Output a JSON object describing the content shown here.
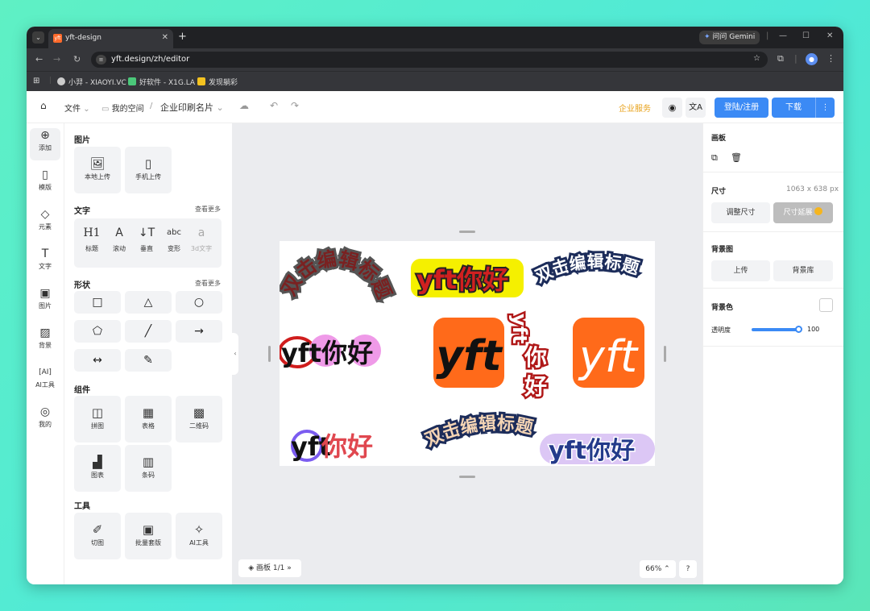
{
  "browser": {
    "tab_title": "yft-design",
    "gemini_label": "问问 Gemini",
    "url": "yft.design/zh/editor",
    "bookmarks": [
      "小羿 - XIAOYI.VC",
      "好软件 - X1G.LA",
      "发现躺彩"
    ]
  },
  "topbar": {
    "file_label": "文件",
    "space_label": "我的空间",
    "separator": "/",
    "doc_title": "企业印刷名片",
    "enterprise_label": "企业服务",
    "login_label": "登陆/注册",
    "download_label": "下载"
  },
  "rail": [
    {
      "icon": "plus-circle-icon",
      "label": "添加"
    },
    {
      "icon": "template-icon",
      "label": "模版"
    },
    {
      "icon": "shapes-icon",
      "label": "元素"
    },
    {
      "icon": "text-icon",
      "label": "文字"
    },
    {
      "icon": "image-icon",
      "label": "图片"
    },
    {
      "icon": "background-icon",
      "label": "背景"
    },
    {
      "icon": "ai-icon",
      "label": "AI工具"
    },
    {
      "icon": "user-icon",
      "label": "我的"
    }
  ],
  "panel": {
    "image_title": "图片",
    "image_items": [
      "本地上传",
      "手机上传"
    ],
    "text_title": "文字",
    "text_more": "查看更多",
    "text_items": [
      {
        "icon": "H1",
        "label": "标题"
      },
      {
        "icon": "A",
        "label": "滚动"
      },
      {
        "icon": "↓T",
        "label": "垂直"
      },
      {
        "icon": "abc",
        "label": "变形"
      },
      {
        "icon": "a",
        "label": "3d文字"
      }
    ],
    "shape_title": "形状",
    "shape_more": "查看更多",
    "component_title": "组件",
    "component_items": [
      "拼图",
      "表格",
      "二维码",
      "图表",
      "条码"
    ],
    "tools_title": "工具",
    "tool_items": [
      "切图",
      "批量套版",
      "AI工具"
    ]
  },
  "canvas": {
    "page_label": "画板 1/1",
    "zoom": "66%",
    "help": "?",
    "texts": {
      "arc_title": "双击编辑标题",
      "yft_hello": "yft你好",
      "yft": "yft",
      "hello": "你好"
    }
  },
  "right": {
    "section_title": "画板",
    "size_label": "尺寸",
    "size_value": "1063 x 638 px",
    "adjust_size": "调整尺寸",
    "extend_size": "尺寸延展",
    "bg_image_label": "背景图",
    "upload_label": "上传",
    "bg_library_label": "背景库",
    "bg_color_label": "背景色",
    "opacity_label": "透明度",
    "opacity_value": "100",
    "opacity": 1.0
  },
  "colors": {
    "accent": "#3b8af5",
    "brand_orange": "#ff6a1a",
    "enterprise": "#e8a21b"
  }
}
